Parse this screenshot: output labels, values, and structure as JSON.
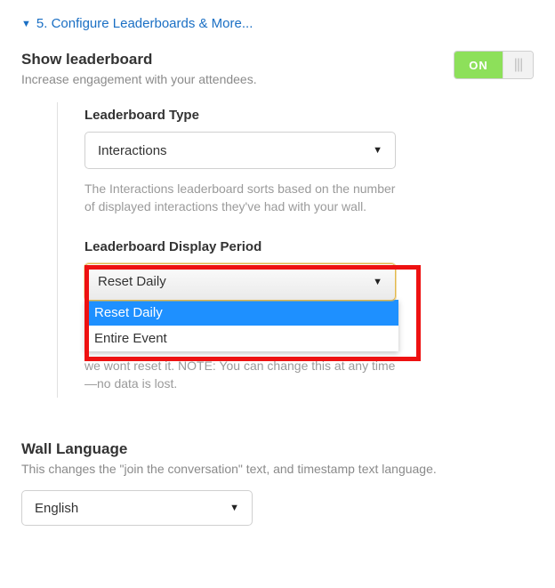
{
  "section": {
    "title": "5. Configure Leaderboards & More..."
  },
  "leaderboard": {
    "title": "Show leaderboard",
    "subtitle": "Increase engagement with your attendees.",
    "toggle_on_label": "ON"
  },
  "type": {
    "label": "Leaderboard Type",
    "selected": "Interactions",
    "help": "The Interactions leaderboard sorts based on the number of displayed interactions they've had with your wall."
  },
  "period": {
    "label": "Leaderboard Display Period",
    "selected": "Reset Daily",
    "option_reset": "Reset Daily",
    "option_entire": "Entire Event",
    "trailing_help": "we wont reset it. NOTE: You can change this at any time—no data is lost."
  },
  "language": {
    "title": "Wall Language",
    "subtitle": "This changes the \"join the conversation\" text, and timestamp text language.",
    "selected": "English"
  }
}
